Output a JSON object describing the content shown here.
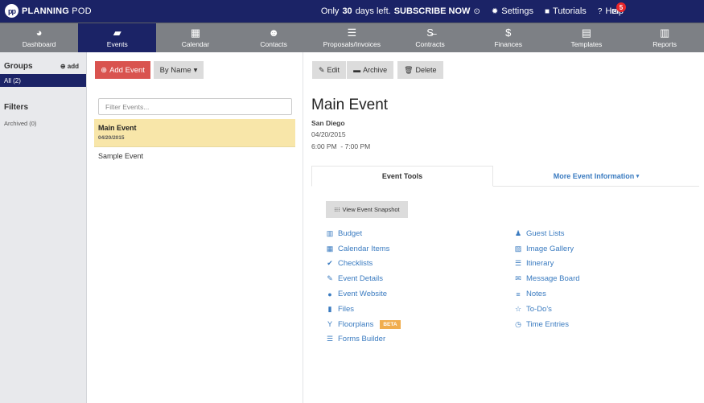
{
  "app": {
    "logo_mark": "pp",
    "logo_bold": "PLANNING",
    "logo_light": " POD"
  },
  "topbar": {
    "subscribe_prefix": "Only ",
    "subscribe_days": "30",
    "subscribe_suffix": " days left. ",
    "subscribe_cta": "SUBSCRIBE NOW",
    "settings": "Settings",
    "tutorials": "Tutorials",
    "help": "Help",
    "mail_count": "5"
  },
  "nav": [
    {
      "label": "Dashboard",
      "icon": "dashboard-icon",
      "glyph": "◕"
    },
    {
      "label": "Events",
      "icon": "book-icon",
      "glyph": "▰"
    },
    {
      "label": "Calendar",
      "icon": "calendar-icon",
      "glyph": "▦"
    },
    {
      "label": "Contacts",
      "icon": "users-icon",
      "glyph": "☻"
    },
    {
      "label": "Proposals/Invoices",
      "icon": "list-icon",
      "glyph": "☰"
    },
    {
      "label": "Contracts",
      "icon": "strikethrough-icon",
      "glyph": "S̶"
    },
    {
      "label": "Finances",
      "icon": "dollar-icon",
      "glyph": "$"
    },
    {
      "label": "Templates",
      "icon": "document-icon",
      "glyph": "▤"
    },
    {
      "label": "Reports",
      "icon": "bar-chart-icon",
      "glyph": "▥"
    }
  ],
  "sidebar": {
    "groups_title": "Groups",
    "add_label": "add",
    "all_label": "All (2)",
    "filters_title": "Filters",
    "archived_label": "Archived (0)"
  },
  "events": {
    "add_button": "Add Event",
    "sort_button": "By Name",
    "filter_placeholder": "Filter Events...",
    "list": [
      {
        "name": "Main Event",
        "date": "04/20/2015",
        "selected": true
      },
      {
        "name": "Sample Event",
        "selected": false
      }
    ]
  },
  "detail": {
    "edit": "Edit",
    "archive": "Archive",
    "delete": "Delete",
    "title": "Main Event",
    "location": "San Diego",
    "date": "04/20/2015",
    "time": "6:00 PM  - 7:00 PM",
    "tab_tools": "Event Tools",
    "tab_more": "More Event Information",
    "snapshot": "View Event Snapshot",
    "tools_left": [
      {
        "label": "Budget",
        "glyph": "▥"
      },
      {
        "label": "Calendar Items",
        "glyph": "▦"
      },
      {
        "label": "Checklists",
        "glyph": "✔"
      },
      {
        "label": "Event Details",
        "glyph": "✎"
      },
      {
        "label": "Event Website",
        "glyph": "●"
      },
      {
        "label": "Files",
        "glyph": "▮"
      },
      {
        "label": "Floorplans",
        "glyph": "Y",
        "badge": "BETA"
      },
      {
        "label": "Forms Builder",
        "glyph": "☰"
      }
    ],
    "tools_right": [
      {
        "label": "Guest Lists",
        "glyph": "♟"
      },
      {
        "label": "Image Gallery",
        "glyph": "▨"
      },
      {
        "label": "Itinerary",
        "glyph": "☰"
      },
      {
        "label": "Message Board",
        "glyph": "✉"
      },
      {
        "label": "Notes",
        "glyph": "≡"
      },
      {
        "label": "To-Do's",
        "glyph": "☆"
      },
      {
        "label": "Time Entries",
        "glyph": "◷"
      }
    ]
  },
  "colors": {
    "brand": "#1b2366",
    "nav_gray": "#7d8085",
    "add_red": "#d9534f",
    "link_blue": "#3a7bc0",
    "selected_row": "#f8e6a9",
    "beta_orange": "#f0ad4e",
    "badge_red": "#e8262b"
  }
}
